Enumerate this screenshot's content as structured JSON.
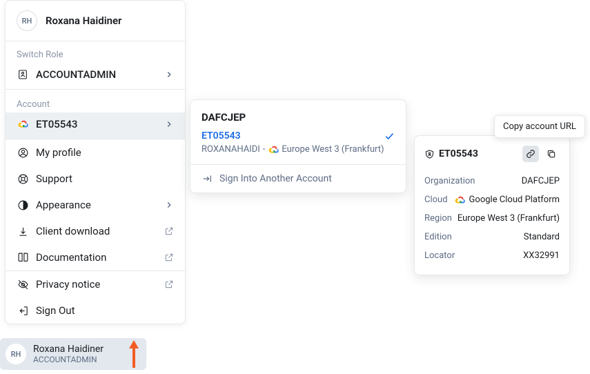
{
  "user": {
    "initials": "RH",
    "name": "Roxana Haidiner"
  },
  "switch_role": {
    "label": "Switch Role",
    "value": "ACCOUNTADMIN"
  },
  "account": {
    "label": "Account",
    "value": "ET05543"
  },
  "menu": {
    "profile": "My profile",
    "support": "Support",
    "appearance": "Appearance",
    "client_download": "Client download",
    "documentation": "Documentation",
    "privacy": "Privacy notice",
    "signout": "Sign Out"
  },
  "flyout": {
    "org": "DAFCJEP",
    "account_id": "ET05543",
    "owner": "ROXANAHAIDI",
    "region": "Europe West 3 (Frankfurt)",
    "signin": "Sign Into Another Account"
  },
  "detail": {
    "title": "ET05543",
    "rows": {
      "organization": {
        "k": "Organization",
        "v": "DAFCJEP"
      },
      "cloud": {
        "k": "Cloud",
        "v": "Google Cloud Platform"
      },
      "region": {
        "k": "Region",
        "v": "Europe West 3 (Frankfurt)"
      },
      "edition": {
        "k": "Edition",
        "v": "Standard"
      },
      "locator": {
        "k": "Locator",
        "v": "XX32991"
      }
    }
  },
  "tooltip": "Copy account URL",
  "bottom": {
    "initials": "RH",
    "name": "Roxana Haidiner",
    "role": "ACCOUNTADMIN"
  }
}
